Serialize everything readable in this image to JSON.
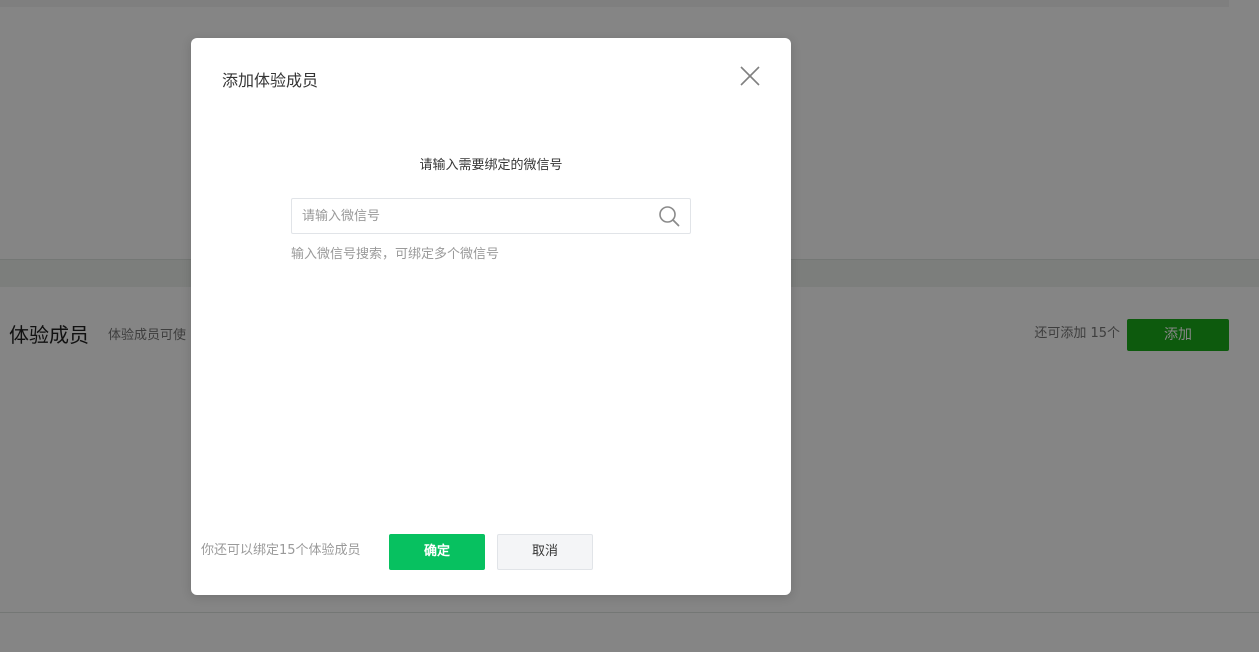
{
  "background": {
    "section_title": "体验成员",
    "section_description": "体验成员可使",
    "remaining_text": "还可添加 15个",
    "add_button_label": "添加",
    "add_button_color": "#1aad19"
  },
  "dialog": {
    "title": "添加体验成员",
    "close_icon": "close-icon",
    "prompt": "请输入需要绑定的微信号",
    "search": {
      "placeholder": "请输入微信号",
      "value": "",
      "icon": "search-icon"
    },
    "hint": "输入微信号搜索，可绑定多个微信号",
    "footer_note": "你还可以绑定15个体验成员",
    "confirm_label": "确定",
    "cancel_label": "取消",
    "confirm_color": "#07c160"
  }
}
